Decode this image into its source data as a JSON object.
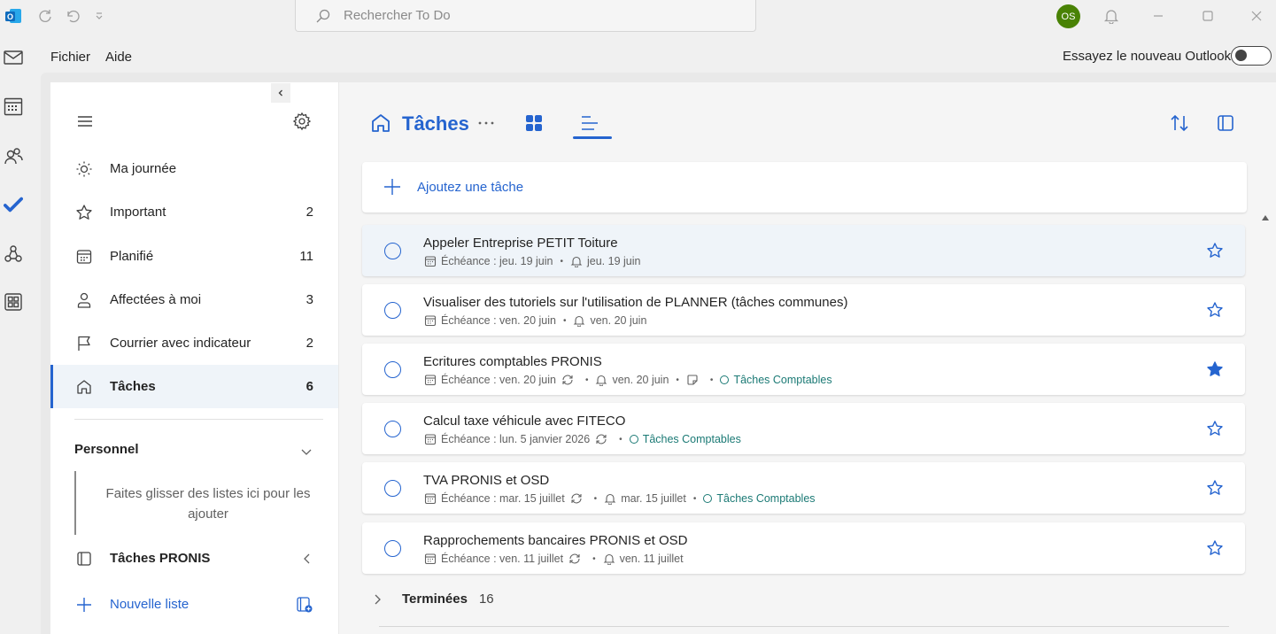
{
  "colors": {
    "accent": "#2564cf",
    "list_teal": "#1b7a75",
    "avatar_bg": "#498205"
  },
  "titlebar": {
    "search_placeholder": "Rechercher To Do",
    "avatar_initials": "OS"
  },
  "menubar": {
    "items": [
      {
        "label": "Fichier"
      },
      {
        "label": "Aide"
      }
    ],
    "try_new_outlook": "Essayez le nouveau Outlook"
  },
  "sidebar": {
    "items": [
      {
        "label": "Ma journée",
        "count": "",
        "icon": "sun-icon"
      },
      {
        "label": "Important",
        "count": "2",
        "icon": "star-icon"
      },
      {
        "label": "Planifié",
        "count": "11",
        "icon": "calendar-icon"
      },
      {
        "label": "Affectées à moi",
        "count": "3",
        "icon": "person-icon"
      },
      {
        "label": "Courrier avec indicateur",
        "count": "2",
        "icon": "flag-icon"
      },
      {
        "label": "Tâches",
        "count": "6",
        "icon": "home-icon"
      }
    ],
    "group": {
      "title": "Personnel",
      "drop_hint": "Faites glisser des listes ici pour les ajouter"
    },
    "list_pronis": {
      "label": "Tâches PRONIS"
    },
    "new_list": {
      "label": "Nouvelle liste"
    }
  },
  "main": {
    "title": "Tâches",
    "add_task_label": "Ajoutez une tâche",
    "tasks": [
      {
        "title": "Appeler Entreprise PETIT Toiture",
        "due": "Échéance : jeu. 19 juin",
        "reminder": "jeu. 19 juin",
        "starred": false,
        "selected": true
      },
      {
        "title": "Visualiser des tutoriels sur l'utilisation de PLANNER (tâches communes)",
        "due": "Échéance : ven. 20 juin",
        "reminder": "ven. 20 juin",
        "starred": false
      },
      {
        "title": "Ecritures comptables PRONIS",
        "due": "Échéance : ven. 20 juin",
        "reminder": "ven. 20 juin",
        "list": "Tâches Comptables",
        "starred": true
      },
      {
        "title": "Calcul taxe véhicule avec FITECO",
        "due": "Échéance : lun. 5 janvier 2026",
        "list": "Tâches Comptables",
        "starred": false
      },
      {
        "title": "TVA PRONIS et OSD",
        "due": "Échéance : mar. 15 juillet",
        "reminder": "mar. 15 juillet",
        "list": "Tâches Comptables",
        "starred": false
      },
      {
        "title": "Rapprochements bancaires PRONIS et OSD",
        "due": "Échéance : ven. 11 juillet",
        "reminder": "ven. 11 juillet",
        "starred": false
      }
    ],
    "completed": {
      "label": "Terminées",
      "count": "16"
    }
  }
}
